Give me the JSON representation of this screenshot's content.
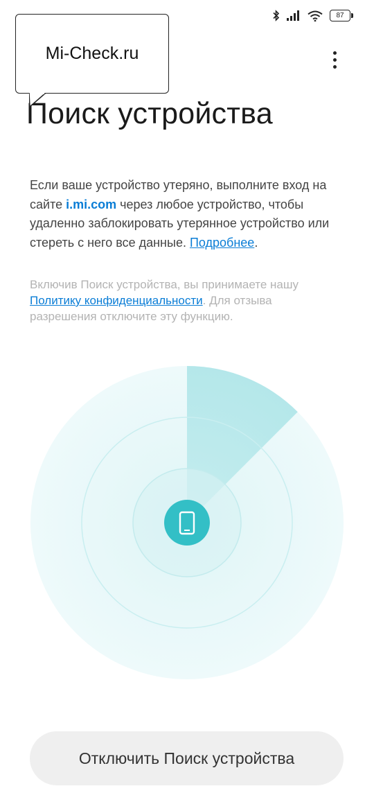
{
  "status_bar": {
    "battery_level": "87",
    "icons": [
      "bluetooth-icon",
      "signal-icon",
      "wifi-icon",
      "battery-icon"
    ]
  },
  "watermark": {
    "text": "Mi-Check.ru"
  },
  "header": {
    "title": "Поиск устройства",
    "more_icon": "more-vertical-icon"
  },
  "description": {
    "text_before_link": "Если ваше устройство утеряно, выполните вход на сайте ",
    "site_link": "i.mi.com",
    "text_after_link": " через любое устройство, чтобы удаленно заблокировать утерянное устройство или стереть с него все данные. ",
    "more_link": "Подробнее",
    "end": "."
  },
  "privacy": {
    "text_before_link": "Включив Поиск устройства, вы принимаете нашу ",
    "policy_link": "Политику конфиденциальности",
    "text_after_link": ". Для отзыва разрешения отключите эту функцию."
  },
  "radar": {
    "center_icon": "smartphone-icon",
    "accent_color": "#33bfc6",
    "sweep_color": "#9fe0e3"
  },
  "actions": {
    "disable_button": "Отключить Поиск устройства"
  }
}
